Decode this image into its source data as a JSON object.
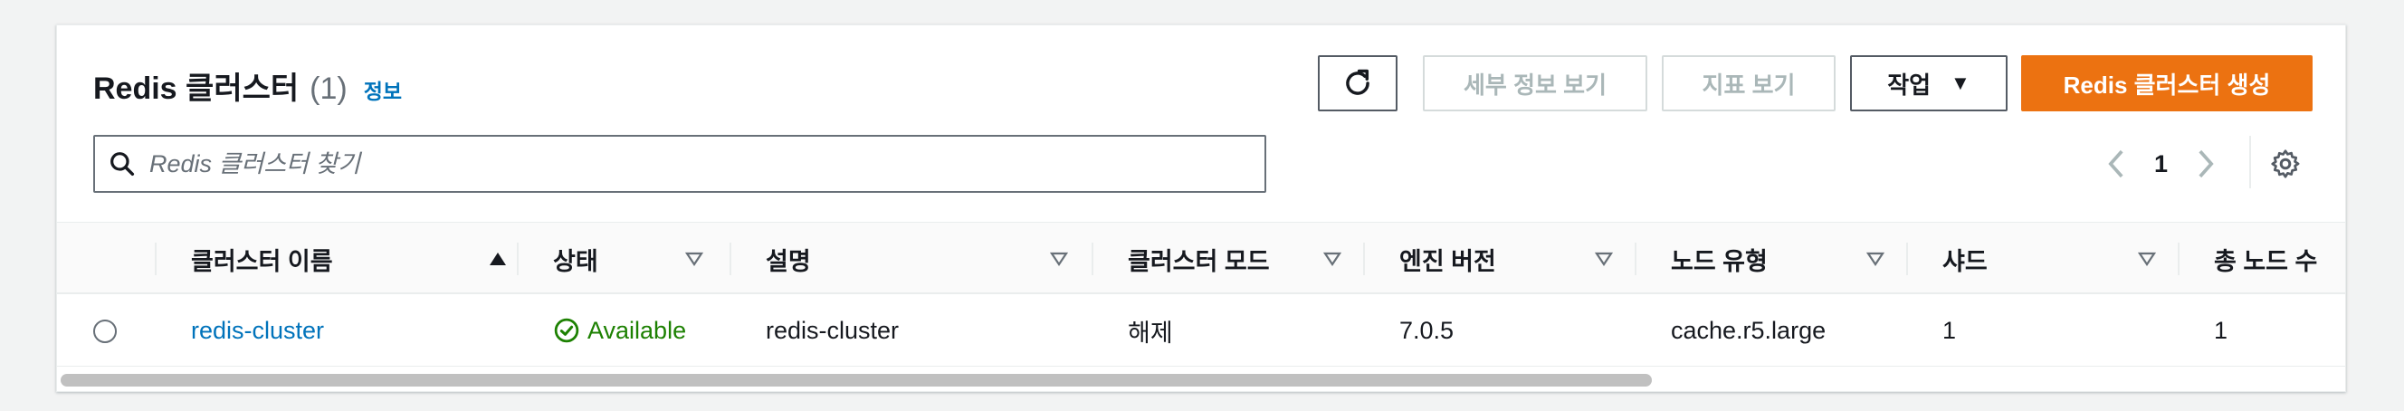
{
  "header": {
    "title": "Redis 클러스터",
    "count": "(1)",
    "info_link": "정보"
  },
  "toolbar": {
    "refresh_icon": "refresh-icon",
    "view_details": "세부 정보 보기",
    "view_metrics": "지표 보기",
    "actions": "작업",
    "create": "Redis 클러스터 생성"
  },
  "search": {
    "placeholder": "Redis 클러스터 찾기",
    "value": ""
  },
  "pagination": {
    "current_page": "1"
  },
  "table": {
    "columns": [
      {
        "label": "클러스터 이름",
        "sort": "ascending"
      },
      {
        "label": "상태",
        "sort": "none"
      },
      {
        "label": "설명",
        "sort": "none"
      },
      {
        "label": "클러스터 모드",
        "sort": "none"
      },
      {
        "label": "엔진 버전",
        "sort": "none"
      },
      {
        "label": "노드 유형",
        "sort": "none"
      },
      {
        "label": "샤드",
        "sort": "none"
      },
      {
        "label": "총 노드 수",
        "sort": "none"
      }
    ],
    "rows": [
      {
        "name": "redis-cluster",
        "status": "Available",
        "description": "redis-cluster",
        "cluster_mode": "해제",
        "engine_version": "7.0.5",
        "node_type": "cache.r5.large",
        "shards": "1",
        "total_nodes": "1"
      }
    ]
  },
  "colors": {
    "primary": "#ec7211",
    "link": "#0073bb",
    "success": "#1d8102"
  }
}
